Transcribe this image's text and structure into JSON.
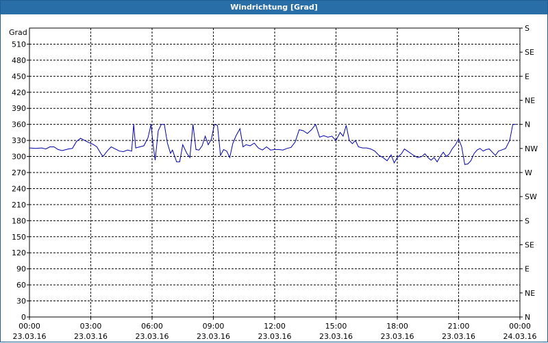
{
  "window": {
    "title": "Windrichtung [Grad]"
  },
  "colors": {
    "titlebar": "#2a6ea8",
    "line": "#0000aa",
    "grid": "#000000"
  },
  "chart_data": {
    "type": "line",
    "title": "Windrichtung [Grad]",
    "ylabel": "Grad",
    "ylim": [
      0,
      540
    ],
    "yticks": [
      0,
      30,
      60,
      90,
      120,
      150,
      180,
      210,
      240,
      270,
      300,
      330,
      360,
      390,
      420,
      450,
      480,
      510
    ],
    "right_ticks": [
      {
        "value": 0,
        "label": "N"
      },
      {
        "value": 45,
        "label": "NE"
      },
      {
        "value": 90,
        "label": "E"
      },
      {
        "value": 135,
        "label": "SE"
      },
      {
        "value": 180,
        "label": "S"
      },
      {
        "value": 225,
        "label": "SW"
      },
      {
        "value": 270,
        "label": "W"
      },
      {
        "value": 315,
        "label": "NW"
      },
      {
        "value": 360,
        "label": "N"
      },
      {
        "value": 405,
        "label": "NE"
      },
      {
        "value": 450,
        "label": "E"
      },
      {
        "value": 495,
        "label": "SE"
      },
      {
        "value": 540,
        "label": "S"
      }
    ],
    "xlim": [
      0,
      24
    ],
    "xticks": [
      {
        "hour": 0,
        "time": "00:00",
        "date": "23.03.16"
      },
      {
        "hour": 3,
        "time": "03:00",
        "date": "23.03.16"
      },
      {
        "hour": 6,
        "time": "06:00",
        "date": "23.03.16"
      },
      {
        "hour": 9,
        "time": "09:00",
        "date": "23.03.16"
      },
      {
        "hour": 12,
        "time": "12:00",
        "date": "23.03.16"
      },
      {
        "hour": 15,
        "time": "15:00",
        "date": "23.03.16"
      },
      {
        "hour": 18,
        "time": "18:00",
        "date": "23.03.16"
      },
      {
        "hour": 21,
        "time": "21:00",
        "date": "23.03.16"
      },
      {
        "hour": 24,
        "time": "00:00",
        "date": "24.03.16"
      }
    ],
    "grid": true,
    "series": [
      {
        "points": [
          [
            0.0,
            316
          ],
          [
            0.3,
            315
          ],
          [
            0.6,
            316
          ],
          [
            0.8,
            314
          ],
          [
            1.0,
            318
          ],
          [
            1.2,
            318
          ],
          [
            1.4,
            313
          ],
          [
            1.6,
            311
          ],
          [
            1.9,
            314
          ],
          [
            2.1,
            315
          ],
          [
            2.3,
            328
          ],
          [
            2.5,
            334
          ],
          [
            2.7,
            330
          ],
          [
            2.9,
            326
          ],
          [
            3.1,
            323
          ],
          [
            3.3,
            318
          ],
          [
            3.5,
            305
          ],
          [
            3.6,
            300
          ],
          [
            3.8,
            310
          ],
          [
            4.0,
            318
          ],
          [
            4.2,
            314
          ],
          [
            4.4,
            310
          ],
          [
            4.6,
            309
          ],
          [
            4.8,
            312
          ],
          [
            5.0,
            310
          ],
          [
            5.1,
            360
          ],
          [
            5.2,
            316
          ],
          [
            5.4,
            318
          ],
          [
            5.6,
            320
          ],
          [
            5.8,
            335
          ],
          [
            5.95,
            360
          ],
          [
            6.05,
            322
          ],
          [
            6.15,
            293
          ],
          [
            6.3,
            348
          ],
          [
            6.45,
            360
          ],
          [
            6.6,
            360
          ],
          [
            6.75,
            325
          ],
          [
            6.9,
            306
          ],
          [
            7.0,
            312
          ],
          [
            7.2,
            290
          ],
          [
            7.35,
            290
          ],
          [
            7.5,
            322
          ],
          [
            7.7,
            306
          ],
          [
            7.85,
            298
          ],
          [
            8.0,
            360
          ],
          [
            8.15,
            313
          ],
          [
            8.3,
            312
          ],
          [
            8.45,
            320
          ],
          [
            8.6,
            338
          ],
          [
            8.75,
            322
          ],
          [
            8.9,
            332
          ],
          [
            9.05,
            360
          ],
          [
            9.2,
            358
          ],
          [
            9.35,
            302
          ],
          [
            9.5,
            313
          ],
          [
            9.65,
            310
          ],
          [
            9.8,
            298
          ],
          [
            9.95,
            324
          ],
          [
            10.1,
            338
          ],
          [
            10.3,
            352
          ],
          [
            10.45,
            318
          ],
          [
            10.6,
            322
          ],
          [
            10.8,
            320
          ],
          [
            11.0,
            325
          ],
          [
            11.2,
            316
          ],
          [
            11.4,
            312
          ],
          [
            11.6,
            318
          ],
          [
            11.8,
            312
          ],
          [
            12.0,
            313
          ],
          [
            12.2,
            313
          ],
          [
            12.4,
            312
          ],
          [
            12.6,
            315
          ],
          [
            12.8,
            317
          ],
          [
            13.0,
            327
          ],
          [
            13.2,
            350
          ],
          [
            13.4,
            348
          ],
          [
            13.6,
            343
          ],
          [
            13.8,
            350
          ],
          [
            14.0,
            360
          ],
          [
            14.2,
            336
          ],
          [
            14.4,
            339
          ],
          [
            14.6,
            336
          ],
          [
            14.8,
            338
          ],
          [
            15.0,
            330
          ],
          [
            15.2,
            345
          ],
          [
            15.35,
            338
          ],
          [
            15.5,
            358
          ],
          [
            15.65,
            330
          ],
          [
            15.8,
            324
          ],
          [
            15.95,
            330
          ],
          [
            16.1,
            318
          ],
          [
            16.3,
            316
          ],
          [
            16.5,
            316
          ],
          [
            16.7,
            314
          ],
          [
            16.9,
            310
          ],
          [
            17.1,
            302
          ],
          [
            17.3,
            298
          ],
          [
            17.5,
            292
          ],
          [
            17.7,
            303
          ],
          [
            17.85,
            288
          ],
          [
            18.0,
            298
          ],
          [
            18.2,
            305
          ],
          [
            18.35,
            314
          ],
          [
            18.5,
            310
          ],
          [
            18.65,
            306
          ],
          [
            18.8,
            302
          ],
          [
            19.0,
            298
          ],
          [
            19.2,
            300
          ],
          [
            19.35,
            305
          ],
          [
            19.5,
            298
          ],
          [
            19.65,
            293
          ],
          [
            19.8,
            298
          ],
          [
            19.95,
            290
          ],
          [
            20.1,
            300
          ],
          [
            20.25,
            308
          ],
          [
            20.4,
            300
          ],
          [
            20.55,
            305
          ],
          [
            20.7,
            315
          ],
          [
            20.85,
            322
          ],
          [
            21.0,
            333
          ],
          [
            21.15,
            318
          ],
          [
            21.3,
            285
          ],
          [
            21.45,
            286
          ],
          [
            21.6,
            292
          ],
          [
            21.75,
            305
          ],
          [
            21.9,
            312
          ],
          [
            22.05,
            315
          ],
          [
            22.2,
            310
          ],
          [
            22.35,
            313
          ],
          [
            22.5,
            314
          ],
          [
            22.65,
            308
          ],
          [
            22.8,
            302
          ],
          [
            22.95,
            310
          ],
          [
            23.1,
            312
          ],
          [
            23.3,
            315
          ],
          [
            23.5,
            330
          ],
          [
            23.65,
            360
          ],
          [
            23.8,
            360
          ]
        ]
      }
    ]
  }
}
